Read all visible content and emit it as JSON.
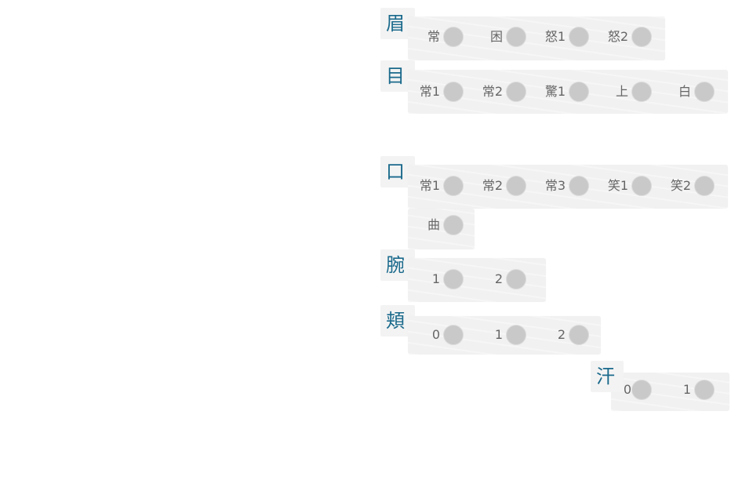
{
  "groups": {
    "mayu": {
      "label": "眉",
      "options": [
        "常",
        "困",
        "怒1",
        "怒2"
      ]
    },
    "me": {
      "label": "目",
      "options": [
        "常1",
        "常2",
        "驚1",
        "上",
        "白"
      ]
    },
    "kuchi": {
      "label": "口",
      "options": [
        "常1",
        "常2",
        "常3",
        "笑1",
        "笑2",
        "曲"
      ]
    },
    "ude": {
      "label": "腕",
      "options": [
        "1",
        "2"
      ]
    },
    "hoho": {
      "label": "頬",
      "options": [
        "0",
        "1",
        "2"
      ]
    },
    "ase": {
      "label": "汗",
      "options": [
        "0",
        "1"
      ]
    }
  }
}
